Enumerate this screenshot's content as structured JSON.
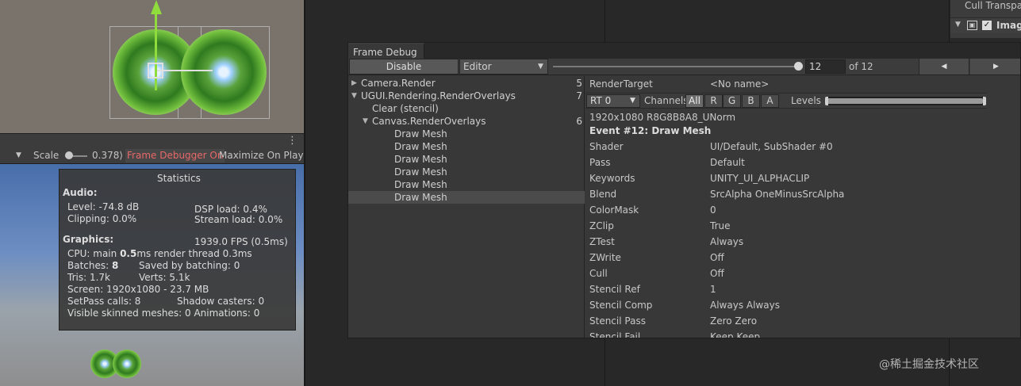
{
  "scene_view": {},
  "game_toolbar": {
    "scale_label": "Scale",
    "scale_value": "0.378⟩",
    "frame_debugger_label": "Frame Debugger On",
    "maximize_label": "Maximize On Play"
  },
  "stats": {
    "title": "Statistics",
    "audio_header": "Audio:",
    "level": "Level: -74.8 dB",
    "dsp_load": "DSP load: 0.4%",
    "clipping": "Clipping: 0.0%",
    "stream_load": "Stream load: 0.0%",
    "graphics_header": "Graphics:",
    "fps": "1939.0 FPS (0.5ms)",
    "cpu_prefix": "CPU: main ",
    "cpu_main": "0.5",
    "cpu_suffix": "ms  render thread 0.3ms",
    "batches_prefix": "Batches: ",
    "batches_value": "8",
    "saved_by_batching": "Saved by batching: 0",
    "tris": "Tris: 1.7k",
    "verts": "Verts: 5.1k",
    "screen": "Screen: 1920x1080 - 23.7 MB",
    "setpass": "SetPass calls: 8",
    "shadow_casters": "Shadow casters: 0",
    "skinned": "Visible skinned meshes: 0  Animations: 0"
  },
  "inspector": {
    "cull_label": "Cull Transparent Mesh",
    "component_label": "Image"
  },
  "frame_debug": {
    "tab_label": "Frame Debug",
    "disable_label": "Disable",
    "target_label": "Editor",
    "event_index": "12",
    "event_total": "of 12",
    "prev_glyph": "◀",
    "next_glyph": "▶",
    "tree": [
      {
        "label": "Camera.Render",
        "count": "5",
        "indent": 0,
        "expander": "▶",
        "selected": false
      },
      {
        "label": "UGUI.Rendering.RenderOverlays",
        "count": "7",
        "indent": 0,
        "expander": "▼",
        "selected": false
      },
      {
        "label": "Clear (stencil)",
        "count": "",
        "indent": 1,
        "expander": "",
        "selected": false
      },
      {
        "label": "Canvas.RenderOverlays",
        "count": "6",
        "indent": 1,
        "expander": "▼",
        "selected": false
      },
      {
        "label": "Draw Mesh",
        "count": "",
        "indent": 2,
        "expander": "",
        "selected": false
      },
      {
        "label": "Draw Mesh",
        "count": "",
        "indent": 2,
        "expander": "",
        "selected": false
      },
      {
        "label": "Draw Mesh",
        "count": "",
        "indent": 2,
        "expander": "",
        "selected": false
      },
      {
        "label": "Draw Mesh",
        "count": "",
        "indent": 2,
        "expander": "",
        "selected": false
      },
      {
        "label": "Draw Mesh",
        "count": "",
        "indent": 2,
        "expander": "",
        "selected": false
      },
      {
        "label": "Draw Mesh",
        "count": "",
        "indent": 2,
        "expander": "",
        "selected": true
      }
    ],
    "render_target_label": "RenderTarget",
    "render_target_value": "<No name>",
    "rt_dropdown": "RT 0",
    "channels_label": "Channels",
    "channels": [
      "All",
      "R",
      "G",
      "B",
      "A"
    ],
    "active_channel": "All",
    "levels_label": "Levels",
    "format": "1920x1080 R8G8B8A8_UNorm",
    "event_title": "Event #12: Draw Mesh",
    "properties": [
      {
        "key": "Shader",
        "value": "UI/Default, SubShader #0"
      },
      {
        "key": "Pass",
        "value": "Default"
      },
      {
        "key": "Keywords",
        "value": "UNITY_UI_ALPHACLIP"
      },
      {
        "key": "Blend",
        "value": "SrcAlpha OneMinusSrcAlpha"
      },
      {
        "key": "ColorMask",
        "value": "0"
      },
      {
        "key": "ZClip",
        "value": "True"
      },
      {
        "key": "ZTest",
        "value": "Always"
      },
      {
        "key": "ZWrite",
        "value": "Off"
      },
      {
        "key": "Cull",
        "value": "Off"
      },
      {
        "key": "Stencil Ref",
        "value": "1"
      },
      {
        "key": "Stencil Comp",
        "value": "Always Always"
      },
      {
        "key": "Stencil Pass",
        "value": "Zero Zero"
      },
      {
        "key": "Stencil Fail",
        "value": "Keep Keep"
      }
    ]
  },
  "watermark": "@稀土掘金技术社区",
  "colors": {
    "panel": "#383838",
    "toolbar": "#3c3c3c",
    "selection": "#4b4b4b",
    "frame_debugger_on": "#e86868"
  }
}
